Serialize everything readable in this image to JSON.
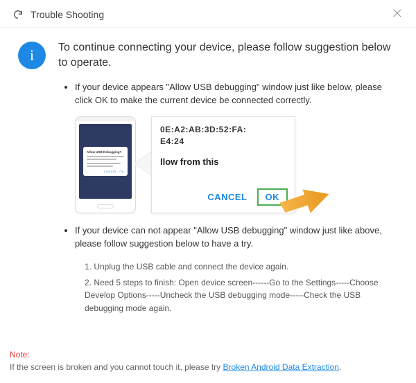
{
  "titlebar": {
    "title": "Trouble Shooting"
  },
  "heading": "To continue connecting your device, please follow suggestion below to operate.",
  "bullets": {
    "first": "If your device appears \"Allow USB debugging\" window just like below, please click OK to make the current device  be connected correctly.",
    "second": "If your device can not appear \"Allow USB debugging\" window just like above, please follow suggestion below to have a try."
  },
  "phone_popup": {
    "title": "Allow USB Debugging?"
  },
  "dialog": {
    "fingerprint_l1": "0E:A2:AB:3D:52:FA:",
    "fingerprint_l2": "E4:24",
    "middle_text": "llow from this",
    "cancel": "CANCEL",
    "ok": "OK"
  },
  "steps": {
    "s1": "1. Unplug the USB cable and connect the device again.",
    "s2": "2. Need 5 steps to finish: Open device screen------Go to the Settings-----Choose Develop Options-----Uncheck the USB debugging mode-----Check the USB debugging mode again."
  },
  "footer": {
    "note_label": "Note:",
    "note_text": "If the screen is broken and you cannot touch it, please try ",
    "link_text": "Broken Android Data Extraction",
    "period": "."
  }
}
